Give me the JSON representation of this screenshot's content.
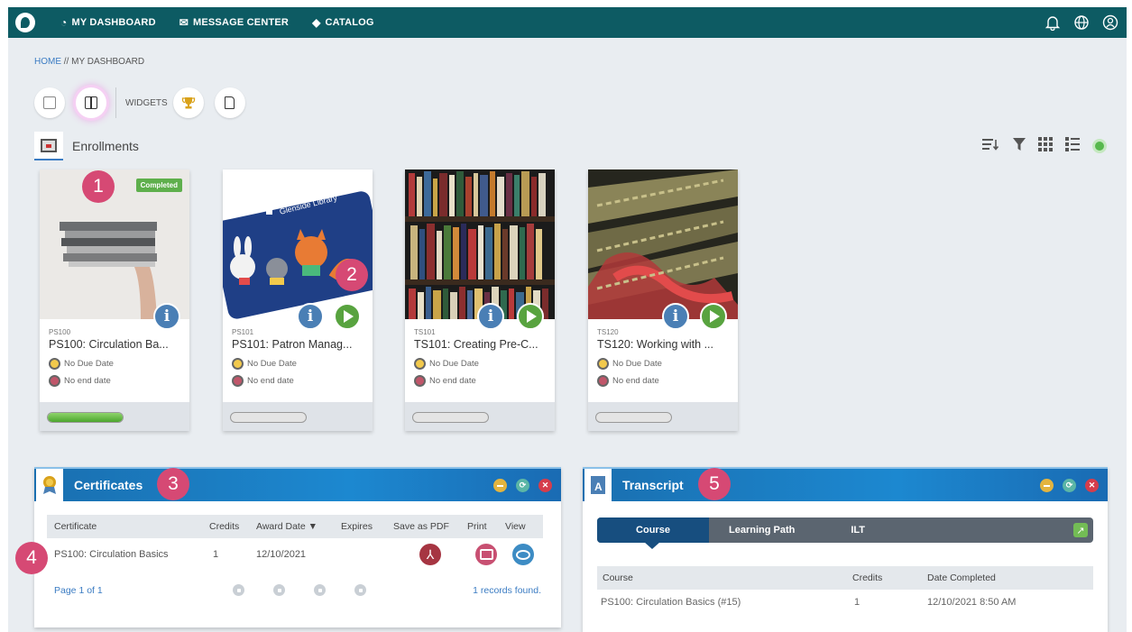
{
  "nav": {
    "dashboard": "MY DASHBOARD",
    "messages": "MESSAGE CENTER",
    "catalog": "CATALOG"
  },
  "breadcrumb": {
    "home": "HOME",
    "sep": " // ",
    "current": "MY DASHBOARD"
  },
  "toolbar": {
    "widgets_label": "WIDGETS"
  },
  "enrollments": {
    "title": "Enrollments",
    "cards": [
      {
        "code": "PS100",
        "title": "PS100: Circulation Ba...",
        "due": "No Due Date",
        "end": "No end date",
        "badge": "Completed",
        "progress": 1.0
      },
      {
        "code": "PS101",
        "title": "PS101: Patron Manag...",
        "due": "No Due Date",
        "end": "No end date",
        "progress": 0
      },
      {
        "code": "TS101",
        "title": "TS101: Creating Pre-C...",
        "due": "No Due Date",
        "end": "No end date",
        "progress": 0
      },
      {
        "code": "TS120",
        "title": "TS120: Working with ...",
        "due": "No Due Date",
        "end": "No end date",
        "progress": 0
      }
    ],
    "card2_image_text": "Glenside Library"
  },
  "callouts": [
    "1",
    "2",
    "3",
    "4",
    "5"
  ],
  "certificates": {
    "title": "Certificates",
    "columns": [
      "Certificate",
      "Credits",
      "Award Date ▼",
      "Expires",
      "Save as PDF",
      "Print",
      "View"
    ],
    "rows": [
      {
        "certificate": "PS100: Circulation Basics",
        "credits": "1",
        "award_date": "12/10/2021",
        "expires": ""
      }
    ],
    "pager": "Page 1 of 1",
    "records": "1 records found."
  },
  "transcript": {
    "title": "Transcript",
    "tabs": [
      "Course",
      "Learning Path",
      "ILT"
    ],
    "columns": [
      "Course",
      "Credits",
      "Date Completed"
    ],
    "rows": [
      {
        "course": "PS100: Circulation Basics (#15)",
        "credits": "1",
        "date": "12/10/2021 8:50 AM"
      }
    ]
  },
  "colors": {
    "nav": "#0d5b63",
    "accent": "#3b7cc3",
    "callout": "#d64974",
    "panel_header": "#1c88d0"
  }
}
